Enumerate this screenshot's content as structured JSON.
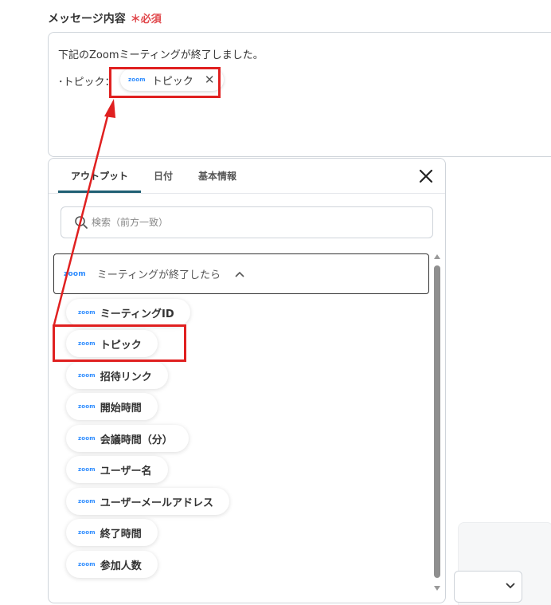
{
  "field": {
    "label": "メッセージ内容",
    "required_mark": "＊必須"
  },
  "editor": {
    "line1": "下記のZoomミーティングが終了しました。",
    "line2_prefix": "･トピック：",
    "chip_logo": "zoom",
    "chip_label": "トピック",
    "chip_close": "✕"
  },
  "popup": {
    "tabs": [
      {
        "label": "アウトプット",
        "active": true
      },
      {
        "label": "日付",
        "active": false
      },
      {
        "label": "基本情報",
        "active": false
      }
    ],
    "search_placeholder": "検索（前方一致）",
    "group": {
      "logo": "zoom",
      "title": "ミーティングが終了したら"
    },
    "items": [
      {
        "logo": "zoom",
        "label": "ミーティングID"
      },
      {
        "logo": "zoom",
        "label": "トピック"
      },
      {
        "logo": "zoom",
        "label": "招待リンク"
      },
      {
        "logo": "zoom",
        "label": "開始時間"
      },
      {
        "logo": "zoom",
        "label": "会議時間（分）"
      },
      {
        "logo": "zoom",
        "label": "ユーザー名"
      },
      {
        "logo": "zoom",
        "label": "ユーザーメールアドレス"
      },
      {
        "logo": "zoom",
        "label": "終了時間"
      },
      {
        "logo": "zoom",
        "label": "参加人数"
      }
    ]
  },
  "colors": {
    "required": "#e0464a",
    "zoom_brand": "#2d8cff",
    "tab_active_underline": "#1f5f73",
    "annotation": "#e02020"
  },
  "icons": {
    "search": "search-icon",
    "close": "close-icon",
    "chevron_up": "chevron-up-icon",
    "chevron_down": "chevron-down-icon"
  }
}
